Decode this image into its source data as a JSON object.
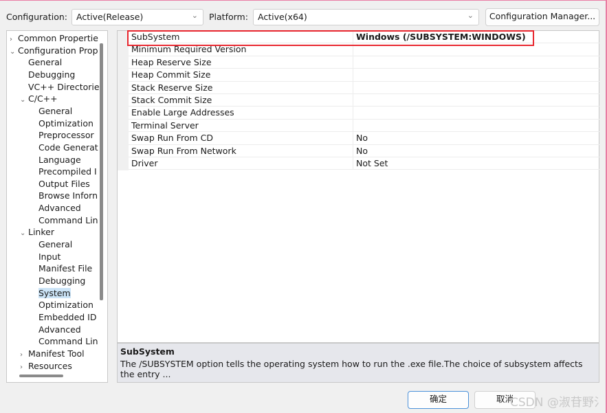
{
  "header": {
    "configuration_label": "Configuration:",
    "configuration_value": "Active(Release)",
    "platform_label": "Platform:",
    "platform_value": "Active(x64)",
    "config_manager": "Configuration Manager..."
  },
  "tree": [
    {
      "label": "Common Propertie",
      "level": 0,
      "twisty": "›"
    },
    {
      "label": "Configuration Prop",
      "level": 0,
      "twisty": "⌄"
    },
    {
      "label": "General",
      "level": 1,
      "twisty": ""
    },
    {
      "label": "Debugging",
      "level": 1,
      "twisty": ""
    },
    {
      "label": "VC++ Directorie",
      "level": 1,
      "twisty": ""
    },
    {
      "label": "C/C++",
      "level": 1,
      "twisty": "⌄"
    },
    {
      "label": "General",
      "level": 2,
      "twisty": ""
    },
    {
      "label": "Optimization",
      "level": 2,
      "twisty": ""
    },
    {
      "label": "Preprocessor",
      "level": 2,
      "twisty": ""
    },
    {
      "label": "Code Generat",
      "level": 2,
      "twisty": ""
    },
    {
      "label": "Language",
      "level": 2,
      "twisty": ""
    },
    {
      "label": "Precompiled I",
      "level": 2,
      "twisty": ""
    },
    {
      "label": "Output Files",
      "level": 2,
      "twisty": ""
    },
    {
      "label": "Browse Inforn",
      "level": 2,
      "twisty": ""
    },
    {
      "label": "Advanced",
      "level": 2,
      "twisty": ""
    },
    {
      "label": "Command Lin",
      "level": 2,
      "twisty": ""
    },
    {
      "label": "Linker",
      "level": 1,
      "twisty": "⌄"
    },
    {
      "label": "General",
      "level": 2,
      "twisty": ""
    },
    {
      "label": "Input",
      "level": 2,
      "twisty": ""
    },
    {
      "label": "Manifest File",
      "level": 2,
      "twisty": ""
    },
    {
      "label": "Debugging",
      "level": 2,
      "twisty": ""
    },
    {
      "label": "System",
      "level": 2,
      "twisty": "",
      "selected": true
    },
    {
      "label": "Optimization",
      "level": 2,
      "twisty": ""
    },
    {
      "label": "Embedded ID",
      "level": 2,
      "twisty": ""
    },
    {
      "label": "Advanced",
      "level": 2,
      "twisty": ""
    },
    {
      "label": "Command Lin",
      "level": 2,
      "twisty": ""
    },
    {
      "label": "Manifest Tool",
      "level": 1,
      "twisty": "›"
    },
    {
      "label": "Resources",
      "level": 1,
      "twisty": "›"
    }
  ],
  "properties": [
    {
      "name": "SubSystem",
      "value": "Windows (/SUBSYSTEM:WINDOWS)",
      "bold": true
    },
    {
      "name": "Minimum Required Version",
      "value": ""
    },
    {
      "name": "Heap Reserve Size",
      "value": ""
    },
    {
      "name": "Heap Commit Size",
      "value": ""
    },
    {
      "name": "Stack Reserve Size",
      "value": ""
    },
    {
      "name": "Stack Commit Size",
      "value": ""
    },
    {
      "name": "Enable Large Addresses",
      "value": ""
    },
    {
      "name": "Terminal Server",
      "value": ""
    },
    {
      "name": "Swap Run From CD",
      "value": "No"
    },
    {
      "name": "Swap Run From Network",
      "value": "No"
    },
    {
      "name": "Driver",
      "value": "Not Set"
    }
  ],
  "description": {
    "title": "SubSystem",
    "text": "The /SUBSYSTEM option tells the operating system how to run the .exe file.The choice of subsystem affects the entry ..."
  },
  "footer": {
    "ok": "确定",
    "cancel": "取消"
  },
  "watermark": "CSDN @淑苷野氵",
  "colors": {
    "highlight_box": "#e8262e",
    "selection": "#cce4f7"
  }
}
